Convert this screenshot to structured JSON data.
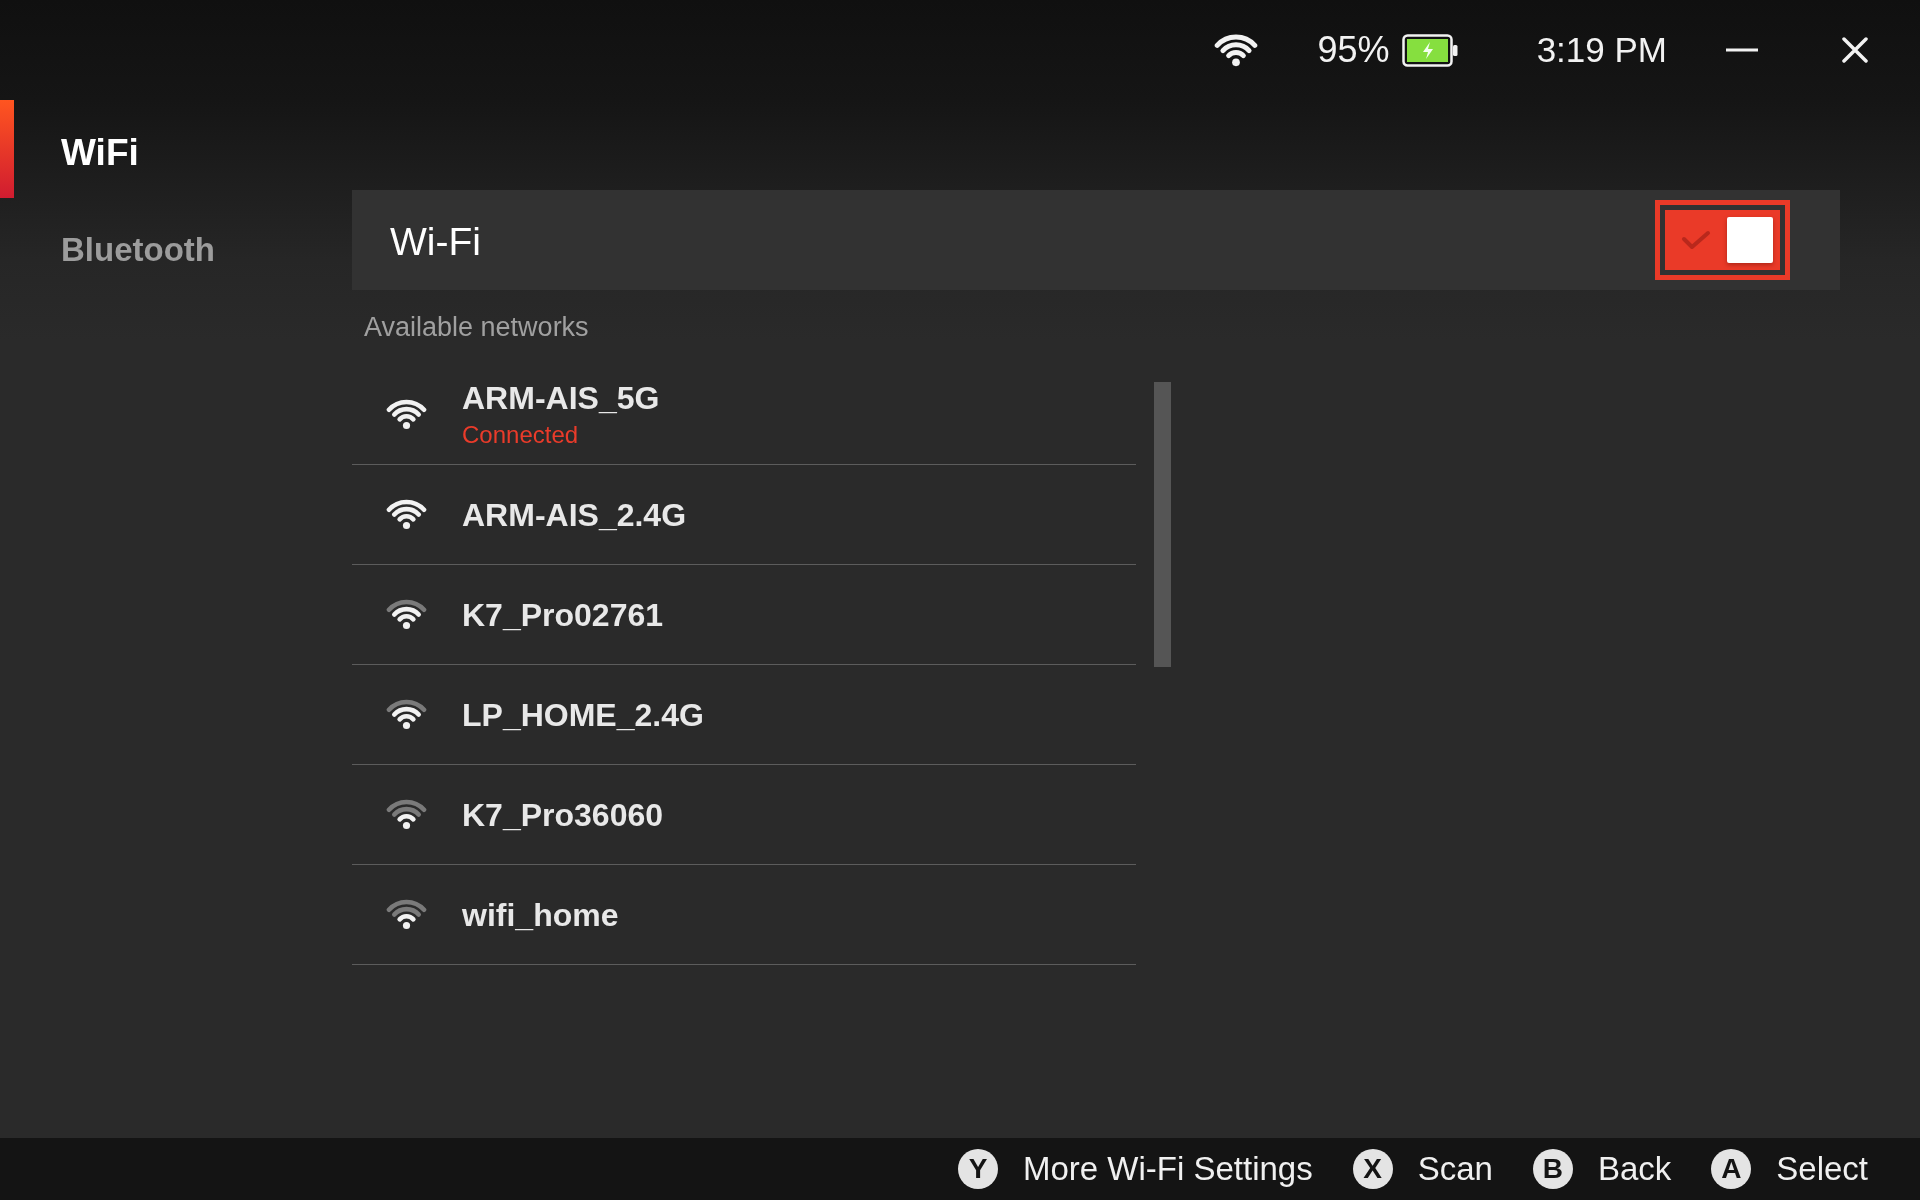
{
  "status_bar": {
    "battery": "95%",
    "time": "3:19 PM"
  },
  "sidebar": {
    "items": [
      {
        "label": "WiFi",
        "selected": true
      },
      {
        "label": "Bluetooth",
        "selected": false
      }
    ]
  },
  "wifi_panel": {
    "label": "Wi-Fi",
    "toggle": {
      "on": true,
      "focused": true
    }
  },
  "networks": {
    "heading": "Available networks",
    "items": [
      {
        "name": "ARM-AIS_5G",
        "status": "Connected",
        "kind": "full"
      },
      {
        "name": "ARM-AIS_2.4G",
        "kind": "full"
      },
      {
        "name": "K7_Pro02761",
        "kind": "good"
      },
      {
        "name": "LP_HOME_2.4G",
        "kind": "good"
      },
      {
        "name": "K7_Pro36060",
        "kind": "fair"
      },
      {
        "name": "wifi_home",
        "kind": "fair"
      }
    ]
  },
  "footer": {
    "actions": [
      {
        "key": "Y",
        "label": "More Wi-Fi Settings"
      },
      {
        "key": "X",
        "label": "Scan"
      },
      {
        "key": "B",
        "label": "Back"
      },
      {
        "key": "A",
        "label": "Select"
      }
    ]
  }
}
